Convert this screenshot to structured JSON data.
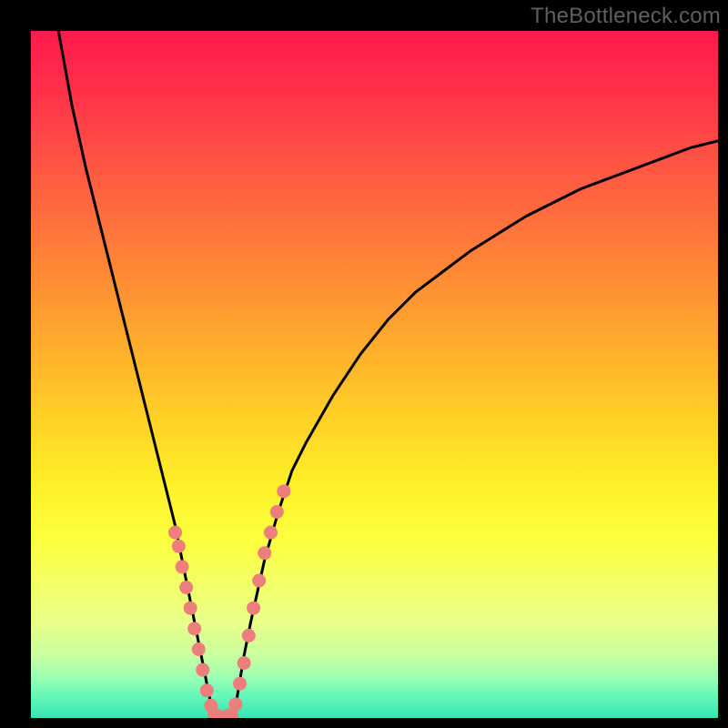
{
  "watermark": "TheBottleneck.com",
  "colors": {
    "curve": "#000000",
    "dots": "#ec7f7c",
    "gradient_top": "#ff1a4d",
    "gradient_bottom": "#34e6b6"
  },
  "chart_data": {
    "type": "line",
    "title": "",
    "xlabel": "",
    "ylabel": "",
    "xlim": [
      0,
      100
    ],
    "ylim": [
      0,
      100
    ],
    "series": [
      {
        "name": "left-curve",
        "x": [
          4,
          6,
          8,
          10,
          12,
          14,
          16,
          17,
          18,
          19,
          20,
          21,
          22,
          23,
          24,
          25,
          26,
          26.6
        ],
        "values": [
          100,
          89,
          80,
          72,
          64,
          56,
          48,
          44,
          40,
          36,
          32,
          28,
          23,
          18,
          13,
          8,
          3,
          0
        ]
      },
      {
        "name": "valley",
        "x": [
          26.6,
          27.5,
          28.5,
          29.5
        ],
        "values": [
          0,
          0,
          0,
          0
        ]
      },
      {
        "name": "right-curve",
        "x": [
          29.5,
          30,
          31,
          32,
          34,
          36,
          38,
          40,
          44,
          48,
          52,
          56,
          60,
          64,
          68,
          72,
          76,
          80,
          84,
          88,
          92,
          96,
          100
        ],
        "values": [
          0,
          3,
          9,
          14,
          23,
          30,
          36,
          40,
          47,
          53,
          58,
          62,
          65,
          68,
          70.5,
          73,
          75,
          77,
          78.5,
          80,
          81.5,
          83,
          84
        ]
      }
    ],
    "annotations": {
      "dots_left": {
        "x": [
          21.0,
          21.5,
          22.0,
          22.6,
          23.2,
          23.8,
          24.4,
          25.0,
          25.6,
          26.2,
          26.7,
          27.2
        ],
        "y": [
          27,
          25,
          22,
          19,
          16,
          13,
          10,
          7,
          4,
          1.8,
          0.5,
          0.3
        ]
      },
      "dots_right": {
        "x": [
          28.6,
          29.2,
          29.8,
          30.4,
          31.0,
          31.7,
          32.4,
          33.2,
          34.0,
          34.9,
          35.8,
          36.8
        ],
        "y": [
          0.3,
          0.5,
          2,
          5,
          8,
          12,
          16,
          20,
          24,
          27,
          30,
          33
        ]
      }
    }
  }
}
